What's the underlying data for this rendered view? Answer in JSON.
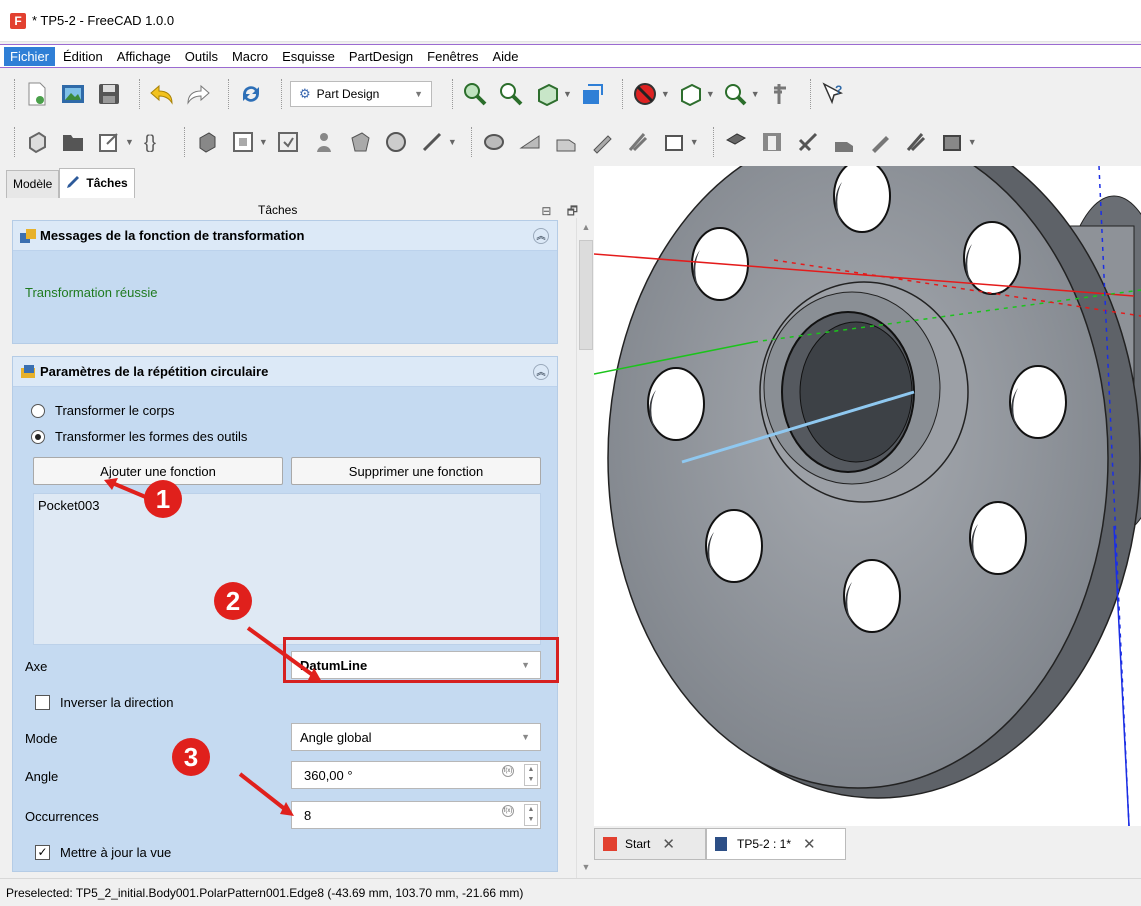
{
  "window": {
    "title": "* TP5-2 - FreeCAD 1.0.0",
    "logo": "F"
  },
  "menu": [
    "Fichier",
    "Édition",
    "Affichage",
    "Outils",
    "Macro",
    "Esquisse",
    "PartDesign",
    "Fenêtres",
    "Aide"
  ],
  "toolbar": {
    "workbench": "Part Design"
  },
  "tabs": {
    "model": "Modèle",
    "tasks": "Tâches"
  },
  "panel": {
    "title": "Tâches",
    "buttons": "⊟ 🗗"
  },
  "messages_box": {
    "title": "Messages de la fonction de transformation",
    "message": "Transformation réussie"
  },
  "params_box": {
    "title": "Paramètres de la répétition circulaire",
    "radio_body": "Transformer le corps",
    "radio_tools": "Transformer les formes des outils",
    "add_btn": "Ajouter une fonction",
    "remove_btn": "Supprimer une fonction",
    "feature_item": "Pocket003",
    "axis_label": "Axe",
    "axis_value": "DatumLine",
    "reverse_label": "Inverser la direction",
    "mode_label": "Mode",
    "mode_value": "Angle global",
    "angle_label": "Angle",
    "angle_value": "360,00 °",
    "occ_label": "Occurrences",
    "occ_value": "8",
    "update_label": "Mettre à jour la vue",
    "update_check": "✓"
  },
  "badges": [
    "1",
    "2",
    "3"
  ],
  "doc_tabs": [
    {
      "label": "Start"
    },
    {
      "label": "TP5-2 : 1*"
    }
  ],
  "status": "Preselected: TP5_2_initial.Body001.PolarPattern001.Edge8 (-43.69 mm, 103.70 mm, -21.66 mm)",
  "colors": {
    "accent_red": "#e0201c",
    "panel_blue": "#c5daf1",
    "success_green": "#1f7a1f"
  }
}
